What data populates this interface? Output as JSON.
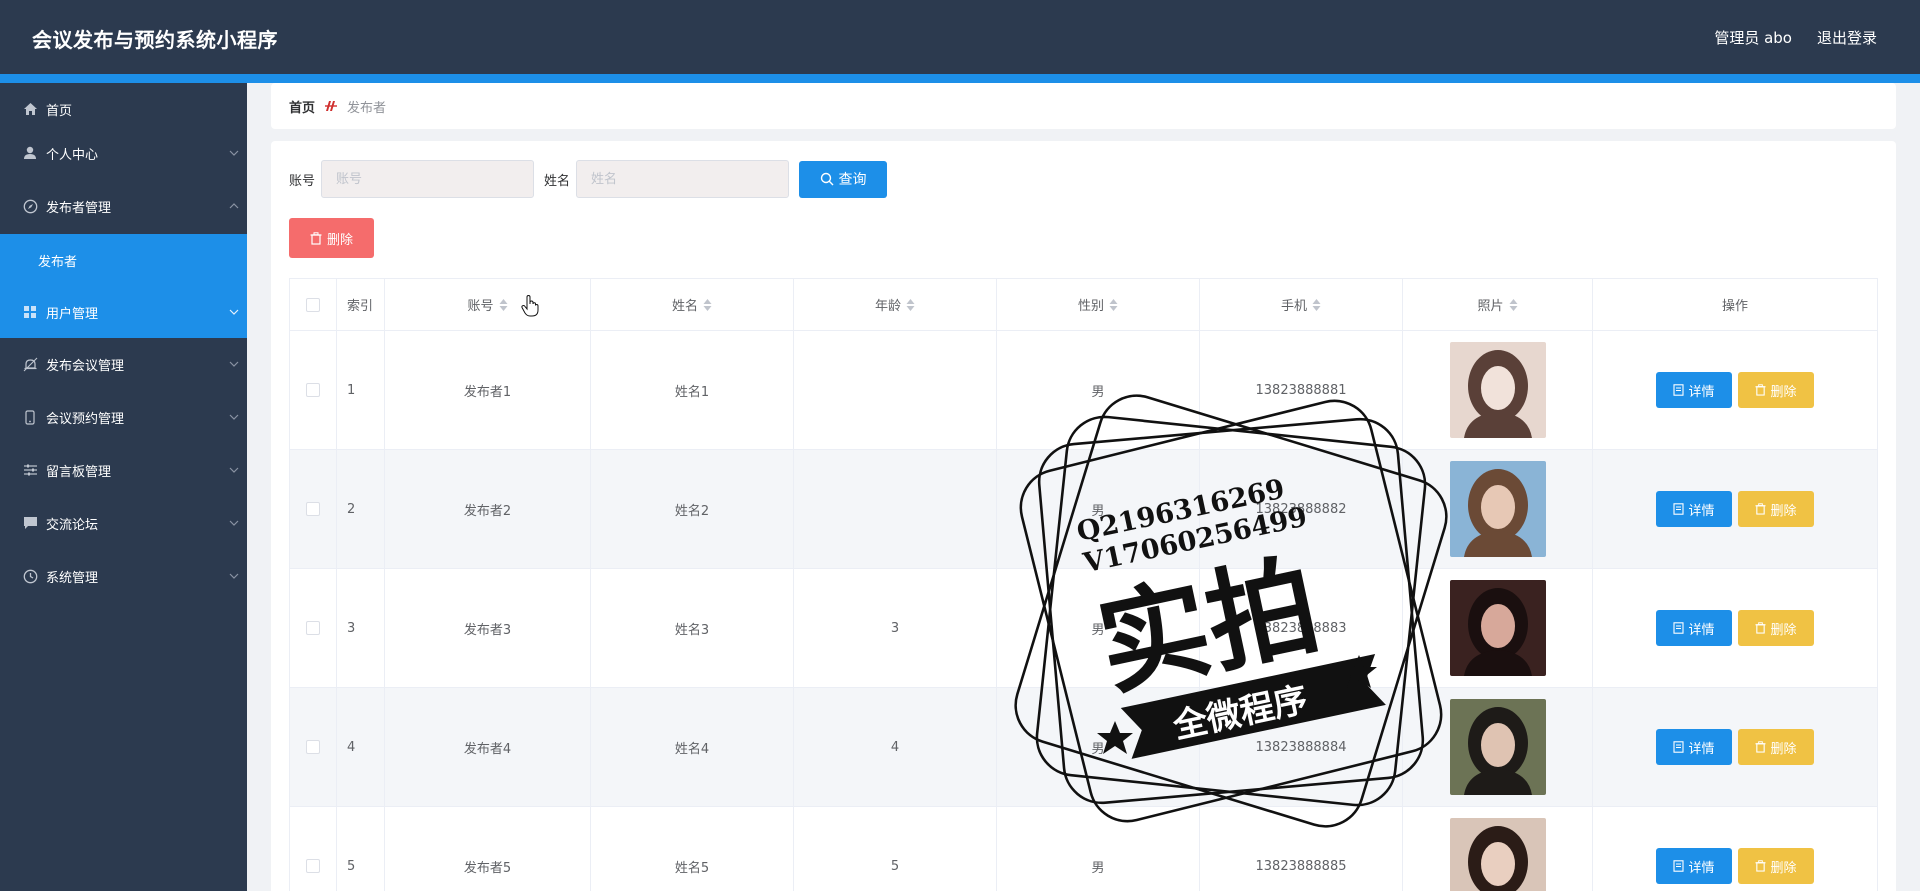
{
  "header": {
    "title": "会议发布与预约系统小程序",
    "user": "管理员 abo",
    "logout": "退出登录"
  },
  "sidebar": {
    "items": [
      {
        "label": "首页",
        "icon": "home-icon"
      },
      {
        "label": "个人中心",
        "icon": "user-icon"
      },
      {
        "label": "发布者管理",
        "icon": "compass-icon"
      },
      {
        "label": "发布者",
        "icon": ""
      },
      {
        "label": "用户管理",
        "icon": "grid-icon"
      },
      {
        "label": "发布会议管理",
        "icon": "bell-icon"
      },
      {
        "label": "会议预约管理",
        "icon": "phone-icon"
      },
      {
        "label": "留言板管理",
        "icon": "sliders-icon"
      },
      {
        "label": "交流论坛",
        "icon": "chat-icon"
      },
      {
        "label": "系统管理",
        "icon": "clock-icon"
      }
    ]
  },
  "breadcrumb": {
    "home": "首页",
    "current": "发布者"
  },
  "search": {
    "account_label": "账号",
    "account_placeholder": "账号",
    "name_label": "姓名",
    "name_placeholder": "姓名",
    "query_button": "查询"
  },
  "toolbar": {
    "delete_button": "删除"
  },
  "table": {
    "headers": {
      "index": "索引",
      "account": "账号",
      "name": "姓名",
      "age": "年龄",
      "gender": "性别",
      "phone": "手机",
      "photo": "照片",
      "actions": "操作"
    },
    "detail_label": "详情",
    "delete_label": "删除",
    "rows": [
      {
        "index": "1",
        "account": "发布者1",
        "name": "姓名1",
        "age": "",
        "gender": "男",
        "phone": "13823888881"
      },
      {
        "index": "2",
        "account": "发布者2",
        "name": "姓名2",
        "age": "",
        "gender": "男",
        "phone": "13823888882"
      },
      {
        "index": "3",
        "account": "发布者3",
        "name": "姓名3",
        "age": "3",
        "gender": "男",
        "phone": "13823888883"
      },
      {
        "index": "4",
        "account": "发布者4",
        "name": "姓名4",
        "age": "4",
        "gender": "男",
        "phone": "13823888884"
      },
      {
        "index": "5",
        "account": "发布者5",
        "name": "姓名5",
        "age": "5",
        "gender": "男",
        "phone": "13823888885"
      }
    ]
  },
  "watermark": {
    "line1": "Q2196316269",
    "line2": "V17060256499",
    "main": "实拍",
    "banner": "全微程序"
  },
  "colors": {
    "header_bg": "#2c3a4f",
    "accent": "#1d8fe8",
    "danger": "#f56c6c",
    "warning": "#f0c244"
  }
}
